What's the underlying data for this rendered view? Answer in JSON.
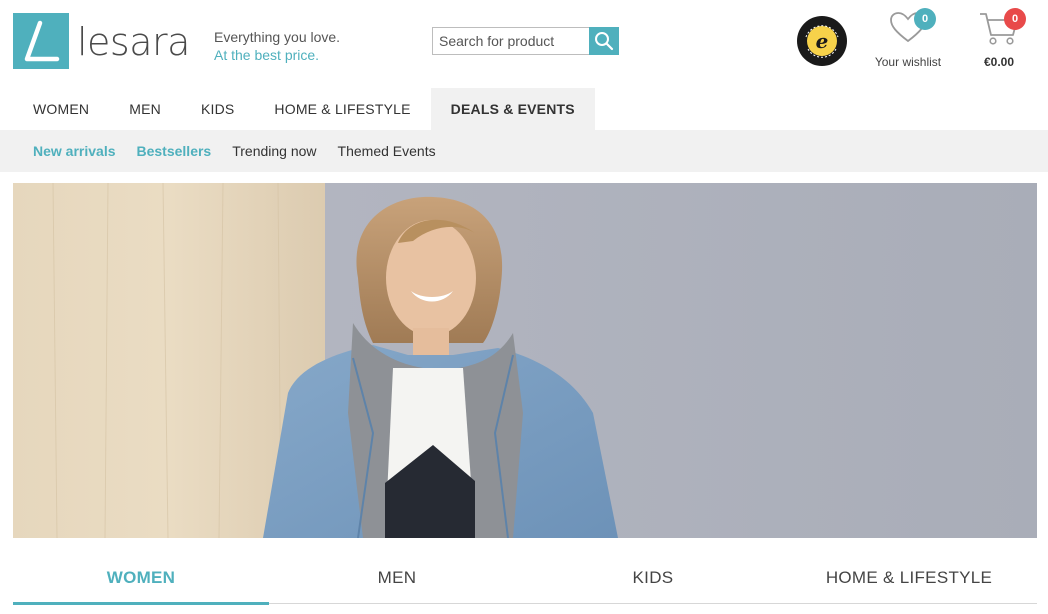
{
  "colors": {
    "accent": "#4fb0bd",
    "cart_badge": "#e84a4a",
    "nav_bg": "#f1f1f1"
  },
  "header": {
    "logo_text": "lesara",
    "tagline_line1": "Everything you love.",
    "tagline_line2": "At the best price.",
    "search": {
      "placeholder": "Search for product",
      "button_icon": "search-icon"
    },
    "trusted_badge": "trusted-shops-badge",
    "wishlist": {
      "label": "Your wishlist",
      "count": "0",
      "icon": "heart-icon"
    },
    "cart": {
      "total": "€0.00",
      "count": "0",
      "icon": "cart-icon"
    }
  },
  "main_nav": {
    "items": [
      {
        "label": "WOMEN",
        "active": false
      },
      {
        "label": "MEN",
        "active": false
      },
      {
        "label": "KIDS",
        "active": false
      },
      {
        "label": "HOME & LIFESTYLE",
        "active": false
      },
      {
        "label": "DEALS & EVENTS",
        "active": true
      }
    ]
  },
  "sub_nav": {
    "items": [
      {
        "label": "New arrivals",
        "highlight": true
      },
      {
        "label": "Bestsellers",
        "highlight": true
      },
      {
        "label": "Trending now",
        "highlight": false
      },
      {
        "label": "Themed Events",
        "highlight": false
      }
    ]
  },
  "hero": {
    "image": "model-in-denim-jacket"
  },
  "category_tabs": {
    "items": [
      {
        "label": "WOMEN",
        "active": true
      },
      {
        "label": "MEN",
        "active": false
      },
      {
        "label": "KIDS",
        "active": false
      },
      {
        "label": "HOME & LIFESTYLE",
        "active": false
      }
    ]
  }
}
